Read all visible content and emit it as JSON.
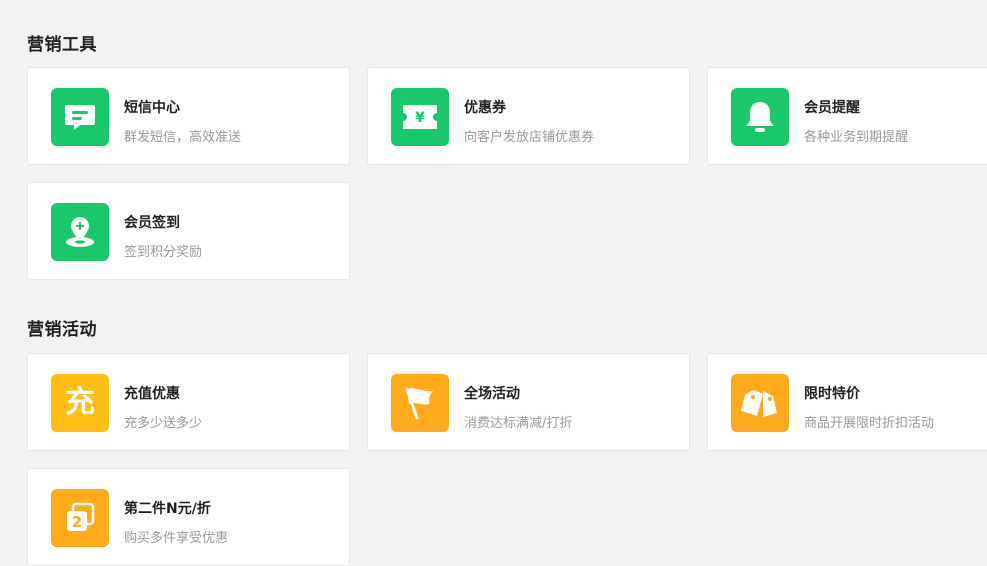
{
  "sections": [
    {
      "title": "营销工具",
      "cards": [
        {
          "name": "短信中心",
          "desc": "群发短信，高效准送",
          "icon": "sms-icon"
        },
        {
          "name": "优惠券",
          "desc": "向客户发放店铺优惠券",
          "icon": "coupon-icon"
        },
        {
          "name": "会员提醒",
          "desc": "各种业务到期提醒",
          "icon": "bell-icon"
        },
        {
          "name": "会员签到",
          "desc": "签到积分奖励",
          "icon": "check-in-icon"
        }
      ]
    },
    {
      "title": "营销活动",
      "cards": [
        {
          "name": "充值优惠",
          "desc": "充多少送多少",
          "icon": "recharge-icon",
          "glyph": "充"
        },
        {
          "name": "全场活动",
          "desc": "消费达标满减/打折",
          "icon": "flag-icon"
        },
        {
          "name": "限时特价",
          "desc": "商品开展限时折扣活动",
          "icon": "price-tag-icon"
        },
        {
          "name": "第二件N元/折",
          "desc": "购买多件享受优惠",
          "icon": "second-item-icon",
          "glyph": "2"
        }
      ]
    }
  ],
  "colors": {
    "green": "#1bc76b",
    "yellow": "#ffbe12",
    "orange": "#ffaa1a"
  }
}
